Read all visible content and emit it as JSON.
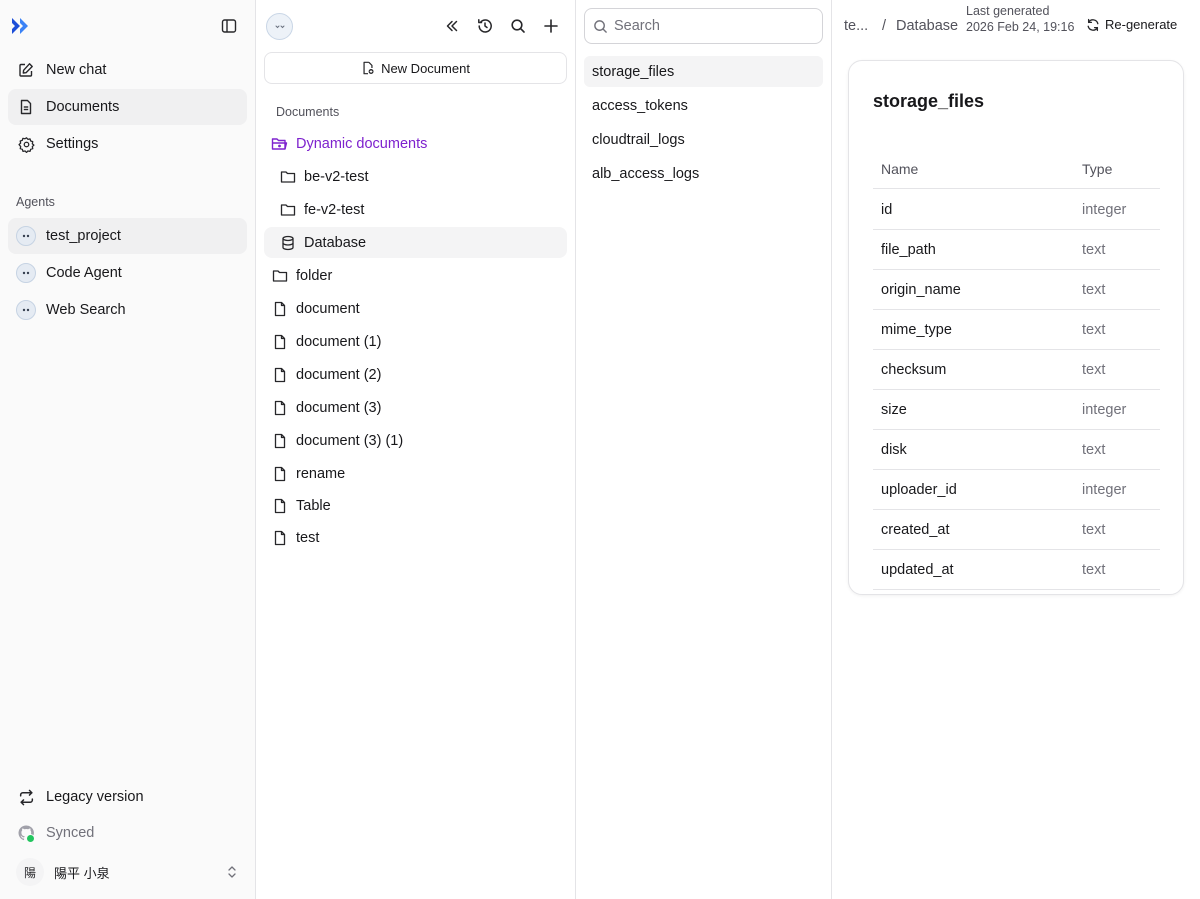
{
  "sidebar": {
    "nav": [
      {
        "label": "New chat",
        "icon": "edit-icon"
      },
      {
        "label": "Documents",
        "icon": "document-icon",
        "active": true
      },
      {
        "label": "Settings",
        "icon": "gear-icon"
      }
    ],
    "agents_label": "Agents",
    "agents": [
      {
        "label": "test_project",
        "active": true
      },
      {
        "label": "Code Agent"
      },
      {
        "label": "Web Search"
      }
    ],
    "legacy_label": "Legacy version",
    "synced_label": "Synced",
    "user": {
      "avatar_text": "陽",
      "name": "陽平 小泉"
    }
  },
  "docs": {
    "new_document_label": "New Document",
    "section_label": "Documents",
    "tree": [
      {
        "label": "Dynamic documents",
        "icon": "folder-open-icon"
      },
      {
        "label": "be-v2-test",
        "icon": "folder-icon"
      },
      {
        "label": "fe-v2-test",
        "icon": "folder-icon"
      },
      {
        "label": "Database",
        "icon": "database-icon",
        "active": true
      },
      {
        "label": "folder",
        "icon": "folder-icon"
      },
      {
        "label": "document",
        "icon": "file-icon"
      },
      {
        "label": "document (1)",
        "icon": "file-icon"
      },
      {
        "label": "document (2)",
        "icon": "file-icon"
      },
      {
        "label": "document (3)",
        "icon": "file-icon"
      },
      {
        "label": "document (3) (1)",
        "icon": "file-icon"
      },
      {
        "label": "rename",
        "icon": "file-icon"
      },
      {
        "label": "Table",
        "icon": "file-icon"
      },
      {
        "label": "test",
        "icon": "file-icon"
      }
    ]
  },
  "tables": {
    "search_placeholder": "Search",
    "items": [
      "storage_files",
      "access_tokens",
      "cloudtrail_logs",
      "alb_access_logs"
    ]
  },
  "detail": {
    "breadcrumb": {
      "parent": "te...",
      "separator": "/",
      "current": "Database"
    },
    "last_generated_label": "Last generated",
    "last_generated_value": "2026 Feb 24, 19:16",
    "regenerate_label": "Re-generate",
    "table_name": "storage_files",
    "columns_header": {
      "name": "Name",
      "type": "Type"
    },
    "columns": [
      {
        "name": "id",
        "type": "integer"
      },
      {
        "name": "file_path",
        "type": "text"
      },
      {
        "name": "origin_name",
        "type": "text"
      },
      {
        "name": "mime_type",
        "type": "text"
      },
      {
        "name": "checksum",
        "type": "text"
      },
      {
        "name": "size",
        "type": "integer"
      },
      {
        "name": "disk",
        "type": "text"
      },
      {
        "name": "uploader_id",
        "type": "integer"
      },
      {
        "name": "created_at",
        "type": "text"
      },
      {
        "name": "updated_at",
        "type": "text"
      }
    ]
  },
  "colors": {
    "accent_blue": "#2563eb",
    "folder_purple": "#7e22ce",
    "synced_green": "#22c55e"
  }
}
